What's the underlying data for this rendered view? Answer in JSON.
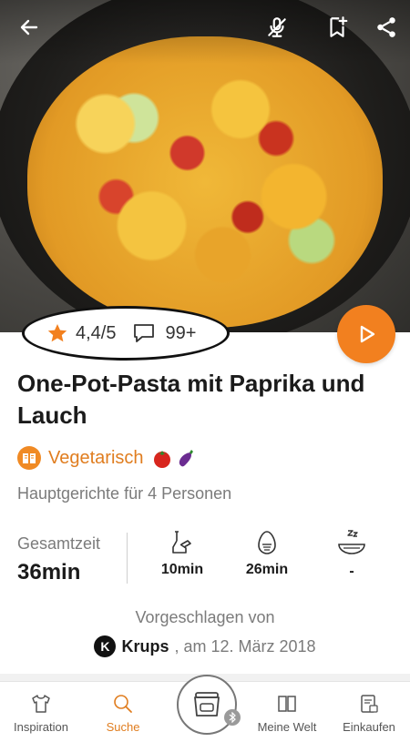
{
  "recipe": {
    "title": "One-Pot-Pasta mit Paprika und Lauch",
    "rating": "4,4/5",
    "comments": "99+",
    "category": "Vegetarisch",
    "category_emojis": [
      "tomato-emoji",
      "eggplant-emoji"
    ],
    "subtitle": "Hauptgerichte für 4 Personen",
    "total_time_label": "Gesamtzeit",
    "total_time": "36min",
    "prep_time": "10min",
    "cook_time": "26min",
    "rest_time": "-",
    "suggested_by_label": "Vorgeschlagen von",
    "author": "Krups",
    "author_logo_letter": "K",
    "date": ", am 12. März 2018"
  },
  "icons": {
    "back": "arrow-left-icon",
    "mute": "microphone-off-icon",
    "bookmark": "bookmark-add-icon",
    "share": "share-icon",
    "star": "star-icon",
    "comment": "speech-bubble-icon",
    "play": "play-icon"
  },
  "colors": {
    "accent": "#f2801f",
    "accent_text": "#e07d1f"
  },
  "nav": {
    "items": [
      {
        "label": "Inspiration",
        "icon": "shirt-icon",
        "active": false
      },
      {
        "label": "Suche",
        "icon": "search-icon",
        "active": true
      },
      {
        "label": "Meine Welt",
        "icon": "book-icon",
        "active": false
      },
      {
        "label": "Einkaufen",
        "icon": "shopping-list-icon",
        "active": false
      }
    ],
    "center": "cooking-device-icon"
  }
}
